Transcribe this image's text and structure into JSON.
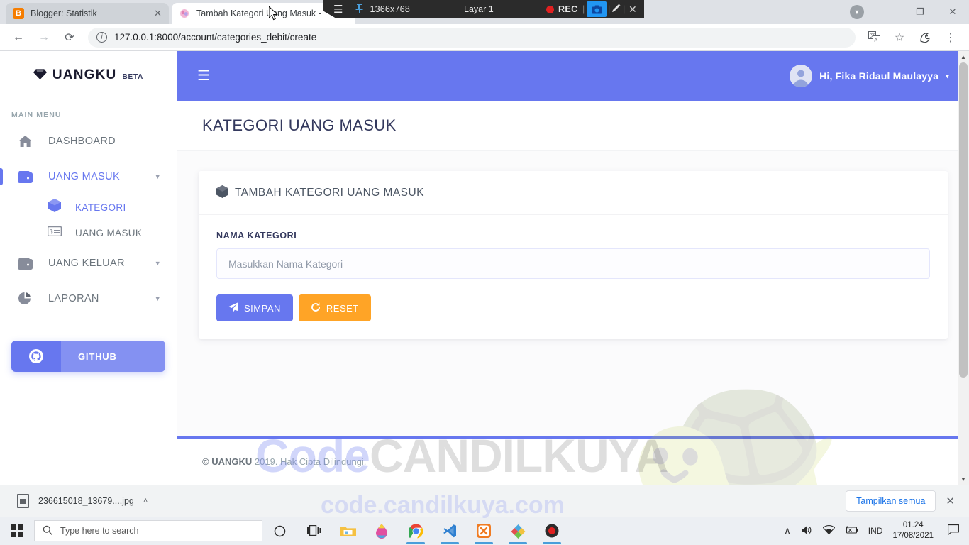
{
  "browser": {
    "tabs": [
      {
        "title": "Blogger: Statistik",
        "favicon": "blogger-icon",
        "active": false,
        "close_label": "✕"
      },
      {
        "title": "Tambah Kategori Uang Masuk -",
        "favicon": "uangku-icon",
        "active": true
      }
    ],
    "url": "127.0.0.1:8000/account/categories_debit/create",
    "back_label": "←",
    "forward_label": "→",
    "reload_label": "⟳",
    "info_label": "i",
    "toolbar_icons": [
      "translate-icon",
      "bookmark-star-icon",
      "extension-icon",
      "chrome-menu-icon"
    ],
    "window_controls": {
      "minimize": "—",
      "restore": "❐",
      "close": "✕",
      "download_indicator": "▼"
    }
  },
  "recorder": {
    "menu_label": "☰",
    "pin_label": "⍠",
    "resolution": "1366x768",
    "screen_label": "Layar 1",
    "rec_label": "REC",
    "camera_icon": "camera-icon",
    "pencil_icon": "pencil-icon",
    "close_label": "✕"
  },
  "sidebar": {
    "brand": {
      "name": "UANGKU",
      "badge": "BETA",
      "logo": "gem-icon"
    },
    "menu_title": "MAIN MENU",
    "items": [
      {
        "label": "DASHBOARD",
        "icon": "home-icon",
        "active": false,
        "caret": false
      },
      {
        "label": "UANG MASUK",
        "icon": "wallet-icon",
        "active": true,
        "caret": true
      },
      {
        "label": "UANG KELUAR",
        "icon": "wallet-icon",
        "active": false,
        "caret": true
      },
      {
        "label": "LAPORAN",
        "icon": "pie-chart-icon",
        "active": false,
        "caret": true
      }
    ],
    "sub_items": [
      {
        "label": "KATEGORI",
        "icon": "cube-icon",
        "active": true
      },
      {
        "label": "UANG MASUK",
        "icon": "money-bill-icon",
        "active": false
      }
    ],
    "github_button": {
      "label": "GITHUB",
      "icon": "github-icon"
    }
  },
  "topbar": {
    "hamburger": "☰",
    "user_greeting": "Hi, Fika Ridaul Maulayya",
    "user_caret": "▾",
    "avatar_icon": "user-avatar-icon"
  },
  "page": {
    "title": "KATEGORI UANG MASUK",
    "card": {
      "icon": "cube-icon",
      "title": "TAMBAH KATEGORI UANG MASUK",
      "field_label": "NAMA KATEGORI",
      "field_value": "",
      "field_placeholder": "Masukkan Nama Kategori",
      "buttons": [
        {
          "label": "SIMPAN",
          "icon": "paper-plane-icon",
          "style": "primary"
        },
        {
          "label": "RESET",
          "icon": "refresh-icon",
          "style": "warning"
        }
      ]
    },
    "footer_brand": "© UANGKU",
    "footer_text": "2019. Hak Cipta Dilindungi."
  },
  "watermark": {
    "code": "Code",
    "candilkuya": "CANDILKUYA",
    "url": "code.candilkuya.com"
  },
  "downloads_shelf": {
    "filename": "236615018_13679....jpg",
    "caret": "˄",
    "show_all_label": "Tampilkan semua",
    "close_label": "✕"
  },
  "taskbar": {
    "search_placeholder": "Type here to search",
    "search_icon": "search-icon",
    "cortana_icon": "cortana-circle-icon",
    "taskview_icon": "task-view-icon",
    "apps": [
      {
        "name": "file-explorer-icon",
        "glyph": "▤",
        "color": "#f5b945",
        "running": false
      },
      {
        "name": "paint-3d-icon",
        "glyph": "◗",
        "color": "#e14fa0",
        "running": false
      },
      {
        "name": "chrome-icon",
        "glyph": "◉",
        "color": "#4285f4",
        "running": true
      },
      {
        "name": "vscode-icon",
        "glyph": "❖",
        "color": "#2f80d0",
        "running": true
      },
      {
        "name": "xampp-icon",
        "glyph": "✖",
        "color": "#f07c23",
        "running": true
      },
      {
        "name": "paint-net-icon",
        "glyph": "◆",
        "color": "#6dc24b",
        "running": true
      },
      {
        "name": "screen-recorder-icon",
        "glyph": "●",
        "color": "#2b2b2b",
        "running": true
      }
    ],
    "tray": {
      "chevron": "∧",
      "volume_icon": "volume-icon",
      "wifi_icon": "wifi-icon",
      "battery_icon": "battery-icon",
      "language": "IND",
      "time": "01.24",
      "date": "17/08/2021",
      "notification_icon": "notification-icon"
    }
  }
}
